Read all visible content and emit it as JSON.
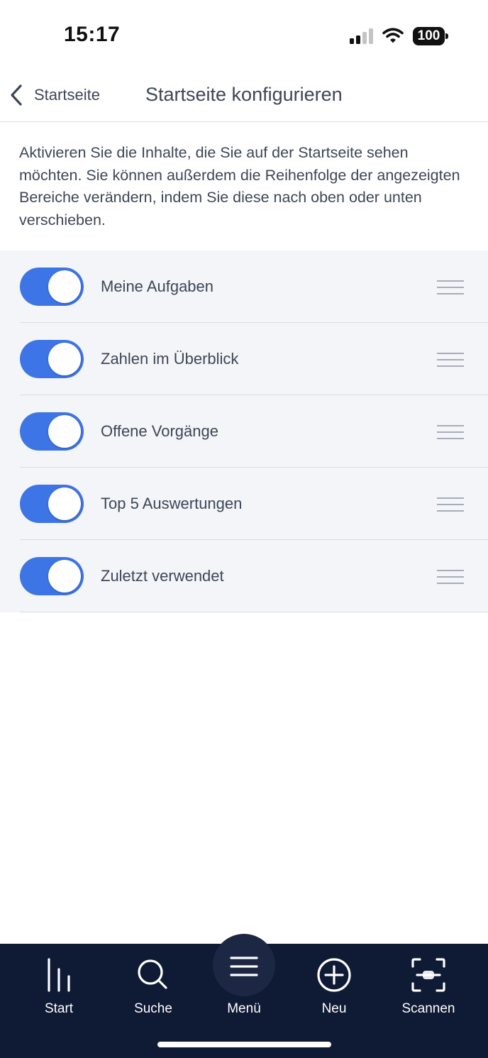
{
  "status": {
    "time": "15:17",
    "battery": "100",
    "icons": [
      "cellular-signal-icon",
      "wifi-icon",
      "battery-icon"
    ]
  },
  "nav": {
    "back_label": "Startseite",
    "title": "Startseite konfigurieren"
  },
  "description": "Aktivieren Sie die Inhalte, die Sie auf der Startseite sehen möchten. Sie können außerdem die Reihenfolge der angezeigten Bereiche verändern, indem Sie diese nach oben oder unten verschieben.",
  "items": [
    {
      "label": "Meine Aufgaben",
      "enabled": true
    },
    {
      "label": "Zahlen im Überblick",
      "enabled": true
    },
    {
      "label": "Offene Vorgänge",
      "enabled": true
    },
    {
      "label": "Top 5 Auswertungen",
      "enabled": true
    },
    {
      "label": "Zuletzt verwendet",
      "enabled": true
    }
  ],
  "tabs": [
    {
      "label": "Start",
      "icon": "bar-chart-icon"
    },
    {
      "label": "Suche",
      "icon": "search-icon"
    },
    {
      "label": "Menü",
      "icon": "hamburger-menu-icon"
    },
    {
      "label": "Neu",
      "icon": "plus-circle-icon"
    },
    {
      "label": "Scannen",
      "icon": "scan-icon"
    }
  ],
  "colors": {
    "accent": "#3e75e6",
    "tab_bar": "#0f1a35",
    "text": "#3d4656",
    "list_bg": "#f4f5f9"
  }
}
